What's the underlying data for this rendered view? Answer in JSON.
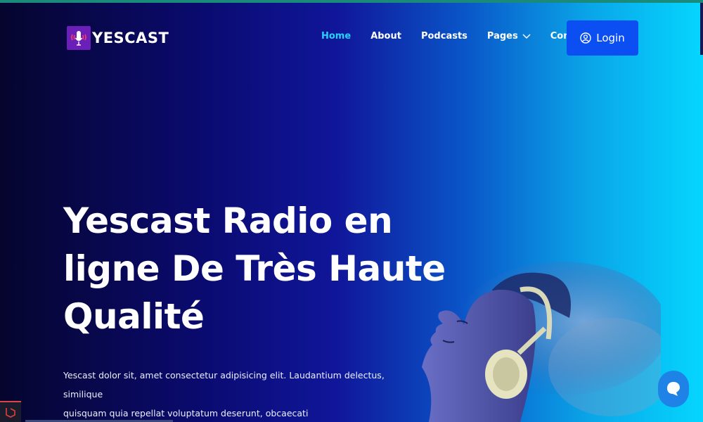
{
  "brand": {
    "name": "YESCAST",
    "logo_icon": "microphone-icon"
  },
  "nav": {
    "items": [
      {
        "label": "Home",
        "active": true
      },
      {
        "label": "About"
      },
      {
        "label": "Podcasts"
      },
      {
        "label": "Pages",
        "has_dropdown": true
      },
      {
        "label": "Contact"
      }
    ]
  },
  "login": {
    "label": "Login",
    "icon": "user-circle-icon"
  },
  "hero": {
    "title_lines": [
      "Yescast Radio en",
      "ligne De Très Haute",
      "Qualité"
    ],
    "description_lines": [
      "Yescast dolor sit, amet consectetur adipisicing elit. Laudantium delectus, similique",
      "quisquam quia repellat voluptatum deserunt, obcaecati"
    ]
  },
  "chat_widget": {
    "icon": "chat-bubble-icon"
  },
  "colors": {
    "accent": "#22d4ff",
    "login_button": "#0b4ff2",
    "logo_bg": "#6a1fb8",
    "chat_button": "#1f82e6"
  }
}
